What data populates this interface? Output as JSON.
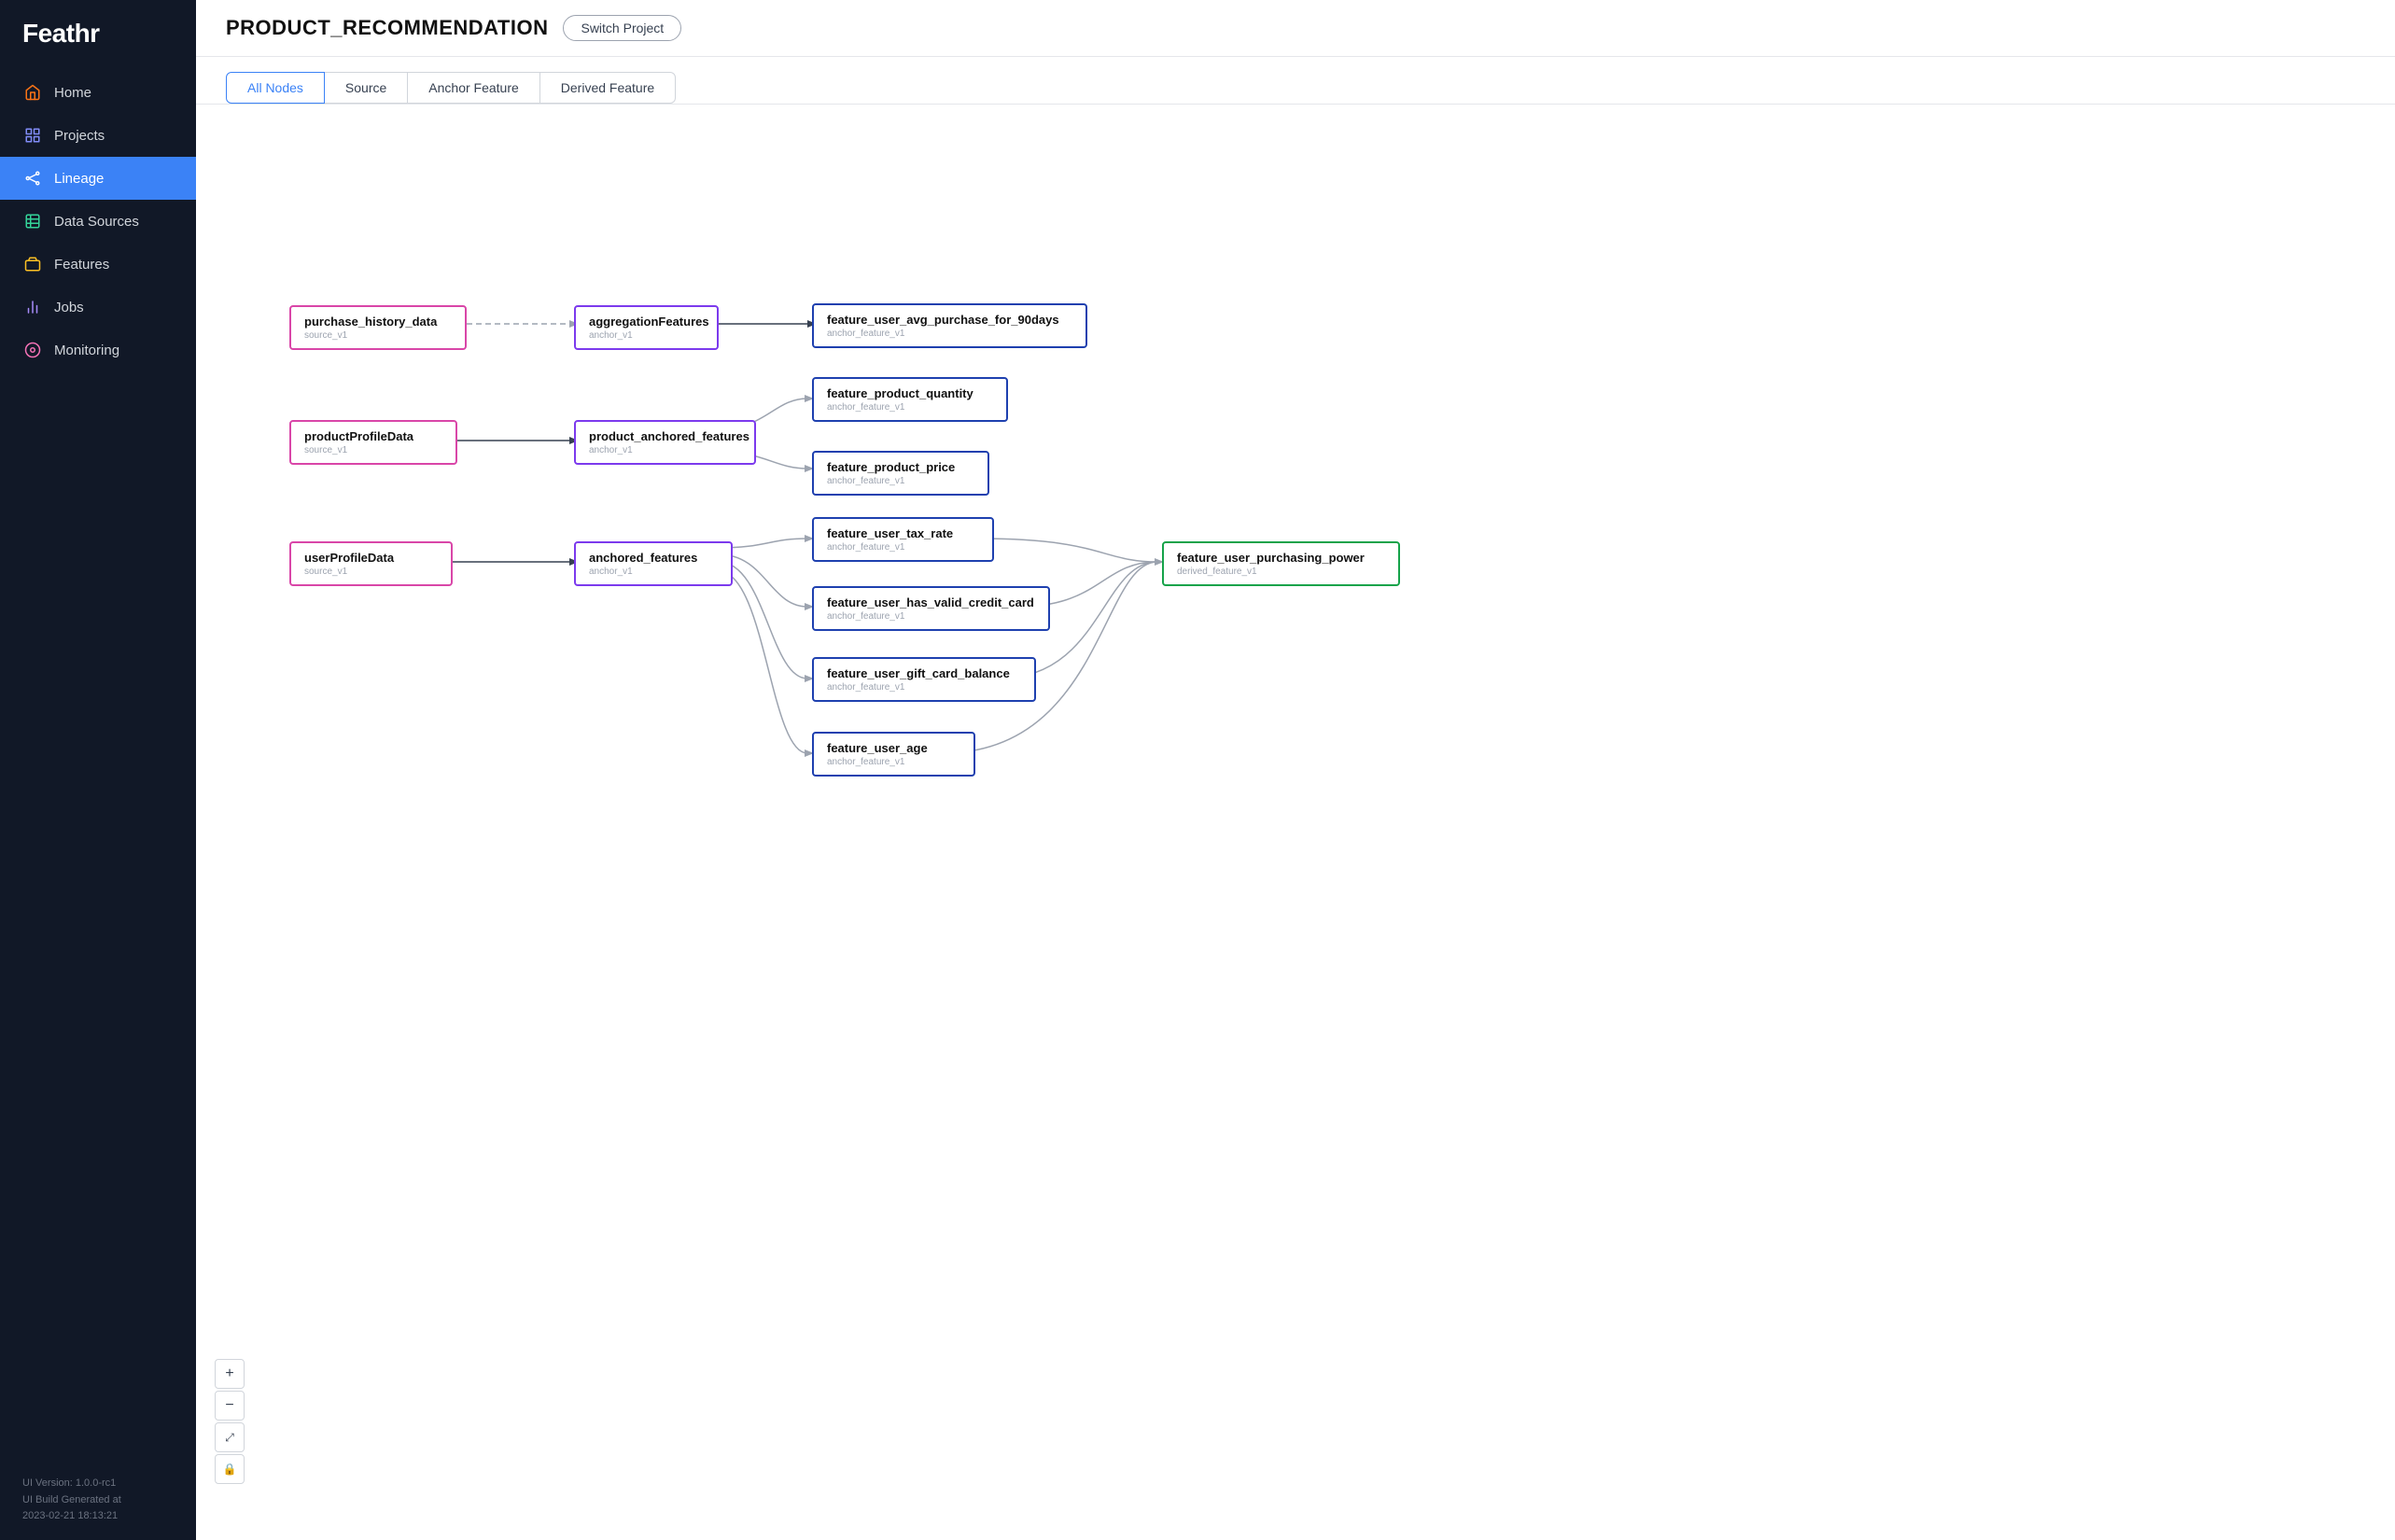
{
  "app": {
    "name": "Feathr"
  },
  "sidebar": {
    "items": [
      {
        "id": "home",
        "label": "Home",
        "icon": "home-icon",
        "active": false
      },
      {
        "id": "projects",
        "label": "Projects",
        "icon": "projects-icon",
        "active": false
      },
      {
        "id": "lineage",
        "label": "Lineage",
        "icon": "lineage-icon",
        "active": true
      },
      {
        "id": "data-sources",
        "label": "Data Sources",
        "icon": "datasources-icon",
        "active": false
      },
      {
        "id": "features",
        "label": "Features",
        "icon": "features-icon",
        "active": false
      },
      {
        "id": "jobs",
        "label": "Jobs",
        "icon": "jobs-icon",
        "active": false
      },
      {
        "id": "monitoring",
        "label": "Monitoring",
        "icon": "monitoring-icon",
        "active": false
      }
    ],
    "version": "UI Version: 1.0.0-rc1",
    "build": "UI Build Generated at",
    "build_date": "2023-02-21 18:13:21"
  },
  "header": {
    "project_name": "PRODUCT_RECOMMENDATION",
    "switch_project_label": "Switch Project"
  },
  "tabs": [
    {
      "id": "all-nodes",
      "label": "All Nodes",
      "active": true
    },
    {
      "id": "source",
      "label": "Source",
      "active": false
    },
    {
      "id": "anchor-feature",
      "label": "Anchor Feature",
      "active": false
    },
    {
      "id": "derived-feature",
      "label": "Derived Feature",
      "active": false
    }
  ],
  "nodes": {
    "sources": [
      {
        "id": "purchase_history_data",
        "label": "purchase_history_data",
        "sub": "source_v1"
      },
      {
        "id": "productProfileData",
        "label": "productProfileData",
        "sub": "source_v1"
      },
      {
        "id": "userProfileData",
        "label": "userProfileData",
        "sub": "source_v1"
      }
    ],
    "anchors": [
      {
        "id": "aggregationFeatures",
        "label": "aggregationFeatures",
        "sub": "anchor_v1"
      },
      {
        "id": "product_anchored_features",
        "label": "product_anchored_features",
        "sub": "anchor_v1"
      },
      {
        "id": "anchored_features",
        "label": "anchored_features",
        "sub": "anchor_v1"
      }
    ],
    "anchor_features": [
      {
        "id": "feature_user_avg_purchase_for_90days",
        "label": "feature_user_avg_purchase_for_90days",
        "sub": "anchor_feature_v1"
      },
      {
        "id": "feature_product_quantity",
        "label": "feature_product_quantity",
        "sub": "anchor_feature_v1"
      },
      {
        "id": "feature_product_price",
        "label": "feature_product_price",
        "sub": "anchor_feature_v1"
      },
      {
        "id": "feature_user_tax_rate",
        "label": "feature_user_tax_rate",
        "sub": "anchor_feature_v1"
      },
      {
        "id": "feature_user_has_valid_credit_card",
        "label": "feature_user_has_valid_credit_card",
        "sub": "anchor_feature_v1"
      },
      {
        "id": "feature_user_gift_card_balance",
        "label": "feature_user_gift_card_balance",
        "sub": "anchor_feature_v1"
      },
      {
        "id": "feature_user_age",
        "label": "feature_user_age",
        "sub": "anchor_feature_v1"
      }
    ],
    "derived": [
      {
        "id": "feature_user_purchasing_power",
        "label": "feature_user_purchasing_power",
        "sub": "derived_feature_v1"
      }
    ]
  },
  "zoom_controls": {
    "zoom_in": "+",
    "zoom_out": "−",
    "fit": "⤢",
    "lock": "🔒"
  }
}
